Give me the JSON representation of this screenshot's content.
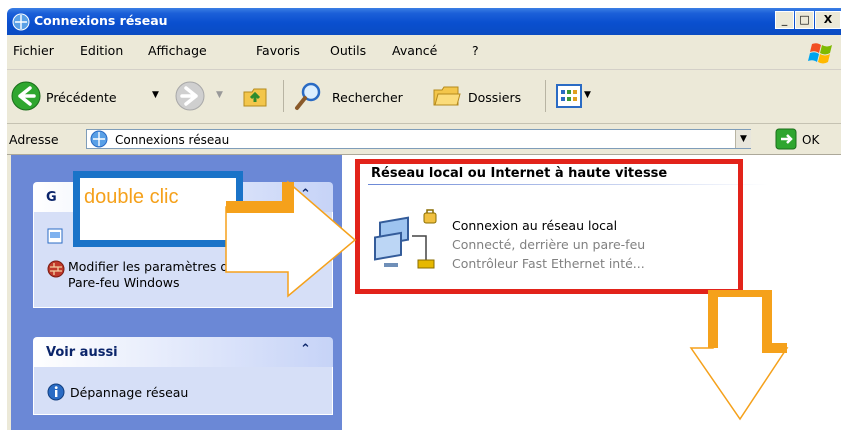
{
  "window": {
    "title": "Connexions réseau",
    "minimize_label": "_",
    "maximize_label": "□",
    "close_label": "X"
  },
  "menu": [
    "Fichier",
    "Edition",
    "Affichage",
    "Favoris",
    "Outils",
    "Avancé",
    "?"
  ],
  "toolbar": {
    "back_label": "Précédente",
    "search_label": "Rechercher",
    "folders_label": "Dossiers"
  },
  "address": {
    "label": "Adresse",
    "value": "Connexions réseau",
    "go_label": "OK"
  },
  "sidebar": {
    "tasks_header_initial": "G",
    "task_item_label": "Modifier les paramètres du Pare-feu Windows",
    "see_also_header": "Voir aussi",
    "see_also_item": "Dépannage réseau"
  },
  "content": {
    "group_header": "Réseau local ou Internet à haute vitesse",
    "connection": {
      "name": "Connexion au réseau local",
      "status": "Connecté, derrière un pare-feu",
      "device": "Contrôleur Fast Ethernet inté..."
    }
  },
  "annotation": {
    "label": "double clic",
    "colors": {
      "label_box": "#1a73c8",
      "label_text": "#f5a11b",
      "arrow": "#f5a11b",
      "highlight_box": "#e2231a"
    }
  },
  "icons": [
    "network-connections-icon",
    "windows-logo-icon",
    "back-arrow-icon",
    "forward-arrow-icon",
    "up-folder-icon",
    "search-icon",
    "folders-icon",
    "views-icon",
    "go-arrow-icon",
    "firewall-icon",
    "info-icon",
    "lan-connection-icon",
    "collapse-chevron-icon"
  ]
}
